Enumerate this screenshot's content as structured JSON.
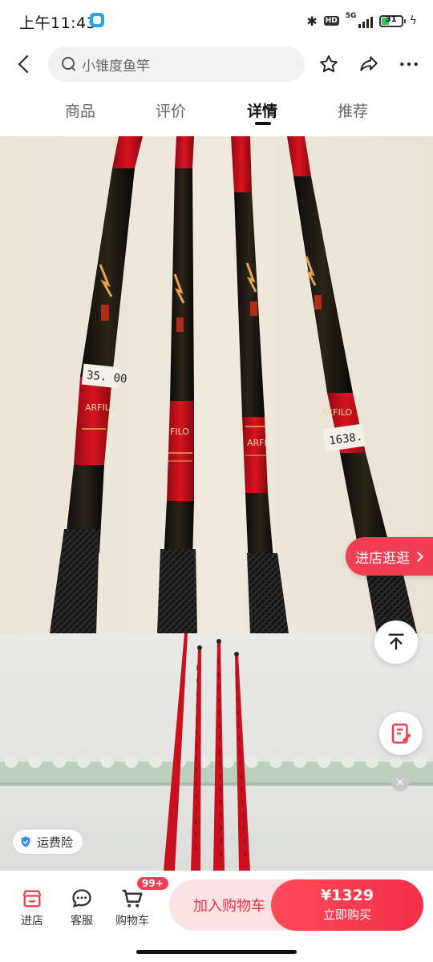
{
  "status_bar": {
    "time": "上午11:43",
    "network": "5G",
    "hd": "HD",
    "battery": "31"
  },
  "nav": {
    "search_text": "小锥度鱼竿"
  },
  "tabs": [
    {
      "label": "商品",
      "active": false
    },
    {
      "label": "评价",
      "active": false
    },
    {
      "label": "详情",
      "active": true
    },
    {
      "label": "推荐",
      "active": false
    }
  ],
  "product_image": {
    "price_tag_left": "35. 00",
    "price_tag_right": "1638.",
    "brand_fragment_1": "ARFILO",
    "brand_fragment_2": "FILO",
    "brand_fragment_3": "ARFI",
    "brand_fragment_4": "ARFILO"
  },
  "floating": {
    "store_label": "进店逛逛",
    "insurance_label": "运费险",
    "close_symbol": "×"
  },
  "bottom_bar": {
    "store_label": "进店",
    "service_label": "客服",
    "cart_label": "购物车",
    "cart_badge": "99+",
    "add_to_cart_label": "加入购物车",
    "price": "¥1329",
    "buy_label": "立即购买"
  },
  "colors": {
    "accent": "#f03f52",
    "add_cart_bg": "#fde3e4",
    "rod_red": "#c8101e"
  }
}
